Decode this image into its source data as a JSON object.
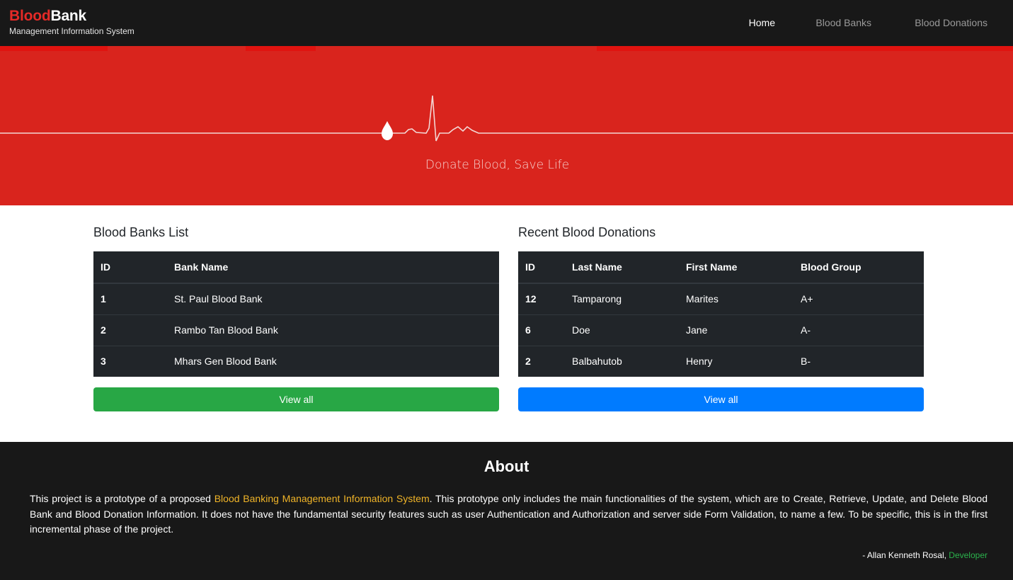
{
  "brand": {
    "title_red": "Blood",
    "title_white": "Bank",
    "subtitle": "Management Information System"
  },
  "nav": {
    "items": [
      "Home",
      "Blood Banks",
      "Blood Donations"
    ],
    "active": "Home"
  },
  "hero": {
    "tagline": "Donate Blood, Save Life"
  },
  "banks": {
    "title": "Blood Banks List",
    "columns": [
      "ID",
      "Bank Name"
    ],
    "rows": [
      [
        "1",
        "St. Paul Blood Bank"
      ],
      [
        "2",
        "Rambo Tan Blood Bank"
      ],
      [
        "3",
        "Mhars Gen Blood Bank"
      ]
    ],
    "button_label": "View all"
  },
  "donations": {
    "title": "Recent Blood Donations",
    "columns": [
      "ID",
      "Last Name",
      "First Name",
      "Blood Group"
    ],
    "rows": [
      [
        "12",
        "Tamparong",
        "Marites",
        "A+"
      ],
      [
        "6",
        "Doe",
        "Jane",
        "A-"
      ],
      [
        "2",
        "Balbahutob",
        "Henry",
        "B-"
      ]
    ],
    "button_label": "View all"
  },
  "about": {
    "title": "About",
    "text_before": "This project is a prototype of a proposed ",
    "highlight": "Blood Banking Management Information System",
    "text_after": ". This prototype only includes the main functionalities of the system, which are to Create, Retrieve, Update, and Delete Blood Bank and Blood Donation Information. It does not have the fundamental security features such as user Authentication and Authorization and server side Form Validation, to name a few. To be specific, this is in the first incremental phase of the project.",
    "credit_name": "- Allan Kenneth Rosal, ",
    "credit_role": "Developer"
  },
  "icons": {
    "hero": "blood-drop-icon"
  },
  "colors": {
    "navbar_bg": "#181818",
    "brand_red": "#e52a27",
    "hero_bg": "#d9241d",
    "table_bg": "#212529",
    "green_button": "#28a745",
    "blue_button": "#007bff",
    "about_highlight": "#f0b428",
    "developer_green": "#2bb24c"
  }
}
